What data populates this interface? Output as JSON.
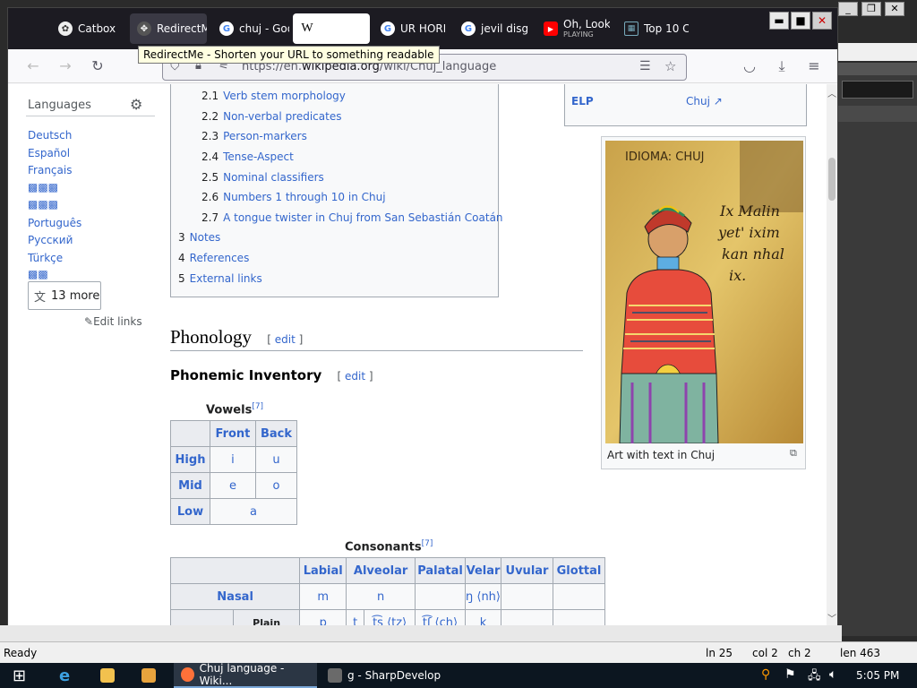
{
  "browser": {
    "tabs": [
      {
        "label": "Catbox",
        "icon": "catbox-icon"
      },
      {
        "label": "RedirectMe",
        "icon": "redirectme-icon"
      },
      {
        "label": "chuj - Google",
        "icon": "google-icon"
      },
      {
        "label": "W",
        "icon": "wikipedia-icon"
      },
      {
        "label": "UR HORI",
        "icon": "google-icon"
      },
      {
        "label": "jevil disg",
        "icon": "google-icon"
      },
      {
        "label": "Oh, Look",
        "sub": "PLAYING",
        "icon": "youtube-icon"
      },
      {
        "label": "Top 10 C",
        "icon": "grid-icon"
      }
    ],
    "tooltip": "RedirectMe - Shorten your URL to something readable",
    "url_prefix": "https://en.",
    "url_domain": "wikipedia.org",
    "url_path": "/wiki/Chuj_language"
  },
  "sidebar": {
    "heading": "Languages",
    "languages": [
      "Deutsch",
      "Español",
      "Français",
      "▩▩▩",
      "▩▩▩",
      "Português",
      "Русский",
      "Türkçe",
      "▩▩"
    ],
    "more_label": "13 more",
    "edit_links": "Edit links"
  },
  "toc": [
    {
      "num": "2.1",
      "label": "Verb stem morphology"
    },
    {
      "num": "2.2",
      "label": "Non-verbal predicates"
    },
    {
      "num": "2.3",
      "label": "Person-markers"
    },
    {
      "num": "2.4",
      "label": "Tense-Aspect"
    },
    {
      "num": "2.5",
      "label": "Nominal classifiers"
    },
    {
      "num": "2.6",
      "label": "Numbers 1 through 10 in Chuj"
    },
    {
      "num": "2.7",
      "label": "A tongue twister in Chuj from San Sebastián Coatán"
    },
    {
      "num": "3",
      "label": "Notes"
    },
    {
      "num": "4",
      "label": "References"
    },
    {
      "num": "5",
      "label": "External links"
    }
  ],
  "infobox": {
    "row_label": "ELP",
    "row_value": "Chuj"
  },
  "image": {
    "painted_text_top": "IDIOMA: CHUJ",
    "painted_text_body": [
      "Ix Malin",
      "yet' ixim",
      "kan nhal",
      "ix."
    ],
    "caption": "Art with text in Chuj"
  },
  "section": {
    "title": "Phonology",
    "edit": "edit",
    "subtitle": "Phonemic Inventory"
  },
  "vowels": {
    "caption": "Vowels",
    "ref": "[7]",
    "headers": [
      "Front",
      "Back"
    ],
    "rows": [
      {
        "label": "High",
        "cells": [
          "i",
          "u"
        ]
      },
      {
        "label": "Mid",
        "cells": [
          "e",
          "o"
        ]
      },
      {
        "label": "Low",
        "cells": [
          "a"
        ]
      }
    ]
  },
  "consonants": {
    "caption": "Consonants",
    "ref": "[7]",
    "headers": [
      "Labial",
      "Alveolar",
      "Palatal",
      "Velar",
      "Uvular",
      "Glottal"
    ],
    "nasal": {
      "label": "Nasal",
      "labial": "m",
      "alveolar": "n",
      "palatal": "",
      "velar": "ŋ ⟨nh⟩",
      "uvular": "",
      "glottal": ""
    },
    "plain": {
      "label": "Plain",
      "labial": "p",
      "alv1": "t",
      "alv2": "t͡s ⟨tz⟩",
      "palatal": "t͡ʃ ⟨ch⟩",
      "velar": "k"
    }
  },
  "app_status": {
    "ready": "Ready",
    "line": "ln 25",
    "col": "col 2",
    "ch": "ch 2",
    "len": "len 463"
  },
  "taskbar": {
    "firefox_item": "Chuj language - Wiki...",
    "sharpdevelop_item": "g - SharpDevelop",
    "time": "5:05 PM"
  },
  "colors": {
    "link": "#3366cc",
    "tab_strip": "#1c1b22",
    "taskbar": "#0c1620"
  }
}
